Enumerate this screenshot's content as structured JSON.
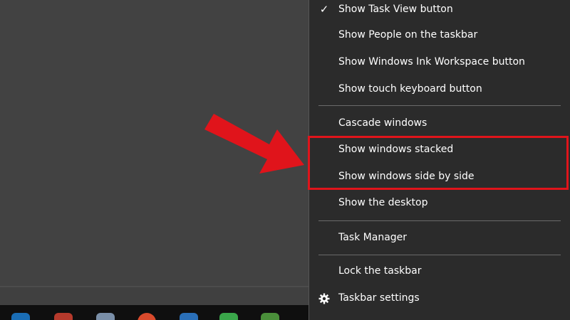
{
  "menu": {
    "items": [
      {
        "label": "Show Task View button",
        "checked": true
      },
      {
        "label": "Show People on the taskbar"
      },
      {
        "label": "Show Windows Ink Workspace button"
      },
      {
        "label": "Show touch keyboard button"
      },
      {
        "label": "Cascade windows"
      },
      {
        "label": "Show windows stacked"
      },
      {
        "label": "Show windows side by side"
      },
      {
        "label": "Show the desktop"
      },
      {
        "label": "Task Manager"
      },
      {
        "label": "Lock the taskbar"
      },
      {
        "label": "Taskbar settings",
        "icon": "gear-icon"
      }
    ]
  },
  "annotation": {
    "color": "#e0141b",
    "highlighted_items": [
      "Show windows stacked",
      "Show windows side by side"
    ]
  },
  "colors": {
    "menu_background": "#2b2b2b",
    "desktop_background": "#424242",
    "taskbar_background": "#0f0f0f"
  }
}
